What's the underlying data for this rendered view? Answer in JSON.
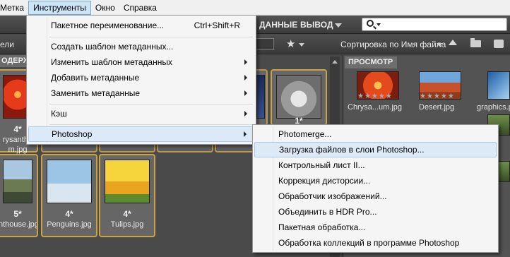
{
  "menubar": {
    "items": [
      "Метка",
      "Инструменты",
      "Окно",
      "Справка"
    ],
    "active_index": 1
  },
  "toolbar": {
    "data_label": "ДАННЫЕ",
    "output_label": "ВЫВОД",
    "search_placeholder": ""
  },
  "pathbar": {
    "left_label": "ели",
    "sort_label": "Сортировка по Имя файла"
  },
  "panels": {
    "content_tab": "ОДЕРЖИ",
    "preview_tab": "ПРОСМОТР"
  },
  "thumbnails": [
    {
      "rating": "4*",
      "name_line1": "rysanthe",
      "name_line2": "m.jpg",
      "picture": "chrysanthemum"
    },
    {
      "rating": "5*",
      "name_line1": "nthouse.jpg",
      "picture": "lighthouse"
    },
    {
      "rating": "4*",
      "name_line1": "Penguins.jpg",
      "picture": "penguins"
    },
    {
      "rating": "4*",
      "name_line1": "Tulips.jpg",
      "picture": "tulips"
    },
    {
      "rating": "1*",
      "picture": "koala"
    }
  ],
  "preview": {
    "items": [
      {
        "name": "Chrysa...um.jpg",
        "stars": "★★★★★"
      },
      {
        "name": "Desert.jpg",
        "stars": "★★★★★"
      },
      {
        "name": "graphics.p",
        "stars": ""
      }
    ]
  },
  "tools_menu": {
    "items": [
      {
        "label": "Пакетное переименование...",
        "shortcut": "Ctrl+Shift+R",
        "submenu": false
      },
      {
        "label": "Создать шаблон метаданных...",
        "submenu": false
      },
      {
        "label": "Изменить шаблон метаданных",
        "submenu": true
      },
      {
        "label": "Добавить метаданные",
        "submenu": true
      },
      {
        "label": "Заменить метаданные",
        "submenu": true
      },
      {
        "label": "Кэш",
        "submenu": true
      },
      {
        "label": "Photoshop",
        "submenu": true,
        "highlighted": true
      }
    ]
  },
  "photoshop_submenu": {
    "items": [
      {
        "label": "Photomerge..."
      },
      {
        "label": "Загрузка файлов в слои Photoshop...",
        "highlighted": true
      },
      {
        "label": "Контрольный лист II..."
      },
      {
        "label": "Коррекция дисторсии..."
      },
      {
        "label": "Обработчик изображений..."
      },
      {
        "label": "Объединить в HDR Pro..."
      },
      {
        "label": "Пакетная обработка..."
      },
      {
        "label": "Обработка коллекций в программе Photoshop"
      }
    ]
  },
  "colors": {
    "menu_highlight": "#dce9f7",
    "thumbnail_border": "#c9a24a",
    "panel_background": "#4a4a4a"
  }
}
